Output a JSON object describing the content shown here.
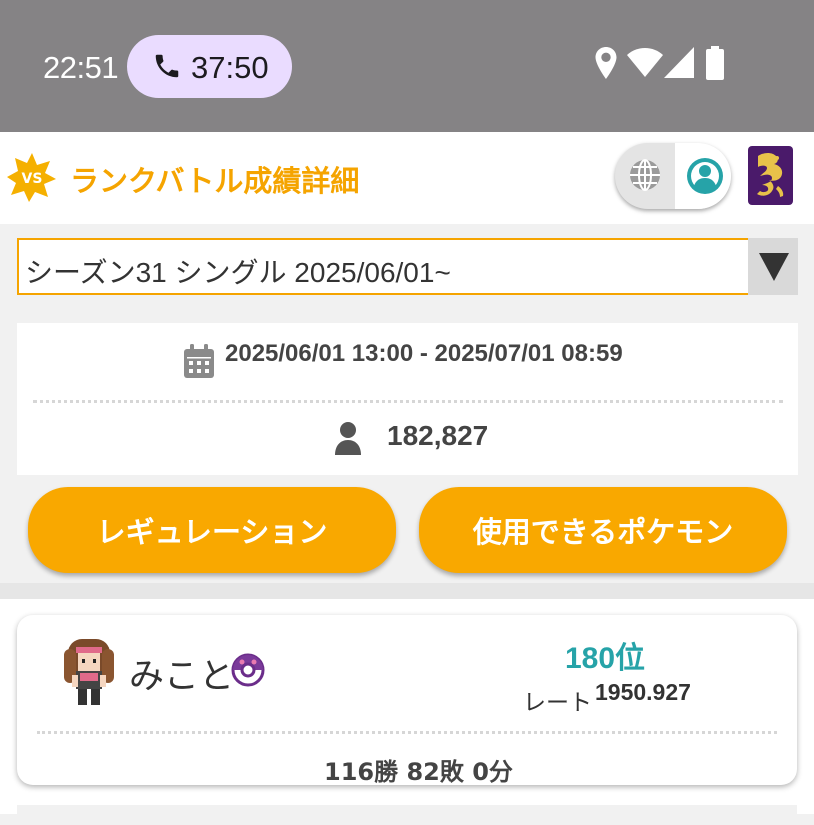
{
  "status_bar": {
    "time": "22:51",
    "call_duration": "37:50",
    "icons": [
      "location-icon",
      "wifi-icon",
      "signal-icon",
      "battery-icon"
    ]
  },
  "header": {
    "logo_icon": "vs-badge-icon",
    "title": "ランクバトル成績詳細",
    "toggle_icons": [
      "globe-icon",
      "user-icon"
    ]
  },
  "season_select": {
    "value": "シーズン31 シングル 2025/06/01~"
  },
  "season_info": {
    "period": "2025/06/01 13:00 - 2025/07/01 08:59",
    "player_count": "182,827"
  },
  "buttons": {
    "regulation": "レギュレーション",
    "usable_pokemon": "使用できるポケモン"
  },
  "ranking": {
    "trainer_name": "みこと",
    "rank": "180位",
    "rate_label": "レート",
    "rate_value": "1950.927",
    "record": "116勝 82敗 0分"
  },
  "colors": {
    "accent": "#f5a400",
    "rank_teal": "#26a3a8",
    "status_bar": "#858385"
  }
}
